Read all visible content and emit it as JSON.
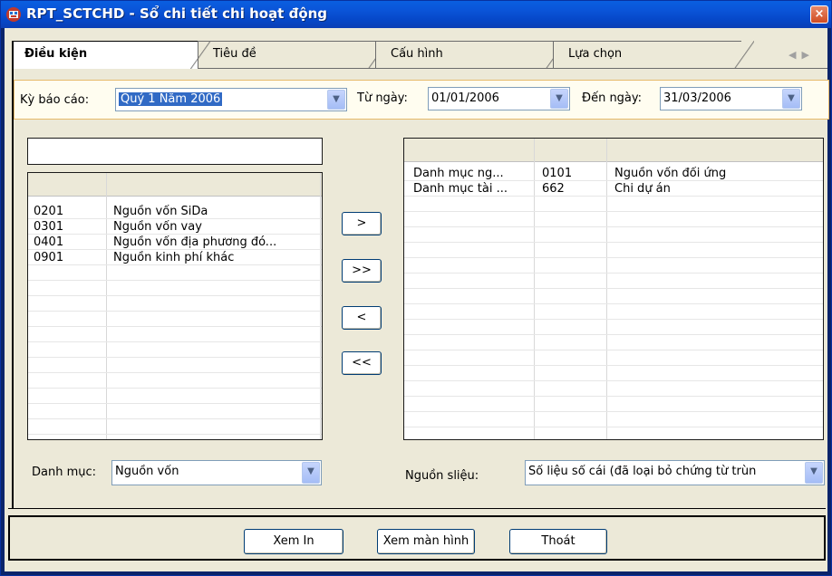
{
  "window": {
    "title": "RPT_SCTCHD - Sổ chi tiết chi hoạt động",
    "close_label": "×"
  },
  "tabs": [
    {
      "label": "Điều kiện",
      "active": true
    },
    {
      "label": "Tiêu đề",
      "active": false
    },
    {
      "label": "Cấu hình",
      "active": false
    },
    {
      "label": "Lựa chọn",
      "active": false
    }
  ],
  "conditions": {
    "period_label": "Kỳ báo cáo:",
    "period_value": "Quý 1 Năm 2006",
    "from_label": "Từ ngày:",
    "from_value": "01/01/2006",
    "to_label": "Đến ngày:",
    "to_value": "31/03/2006"
  },
  "left_list": {
    "rows": [
      {
        "code": "0201",
        "name": "Nguồn vốn SiDa"
      },
      {
        "code": "0301",
        "name": "Nguồn vốn vay"
      },
      {
        "code": "0401",
        "name": "Nguồn vốn địa phương đó..."
      },
      {
        "code": "0901",
        "name": "Nguồn kinh phí khác"
      }
    ]
  },
  "move_buttons": {
    "add_one": ">",
    "add_all": ">>",
    "remove_one": "<",
    "remove_all": "<<"
  },
  "right_list": {
    "rows": [
      {
        "category": "Danh mục ng...",
        "code": "0101",
        "name": "Nguồn vốn đối ứng"
      },
      {
        "category": "Danh mục tài ...",
        "code": "662",
        "name": "Chi dự án"
      }
    ]
  },
  "category": {
    "label": "Danh mục:",
    "value": "Nguồn vốn"
  },
  "data_source": {
    "label": "Nguồn sliệu:",
    "value": "Số liệu sổ cái (đã loại bỏ chứng từ trùn"
  },
  "buttons": {
    "preview": "Xem In",
    "screen": "Xem màn hình",
    "exit": "Thoát"
  },
  "colors": {
    "titlebar": "#0a54d8",
    "selection": "#316ac5",
    "panel": "#ece9d8"
  }
}
